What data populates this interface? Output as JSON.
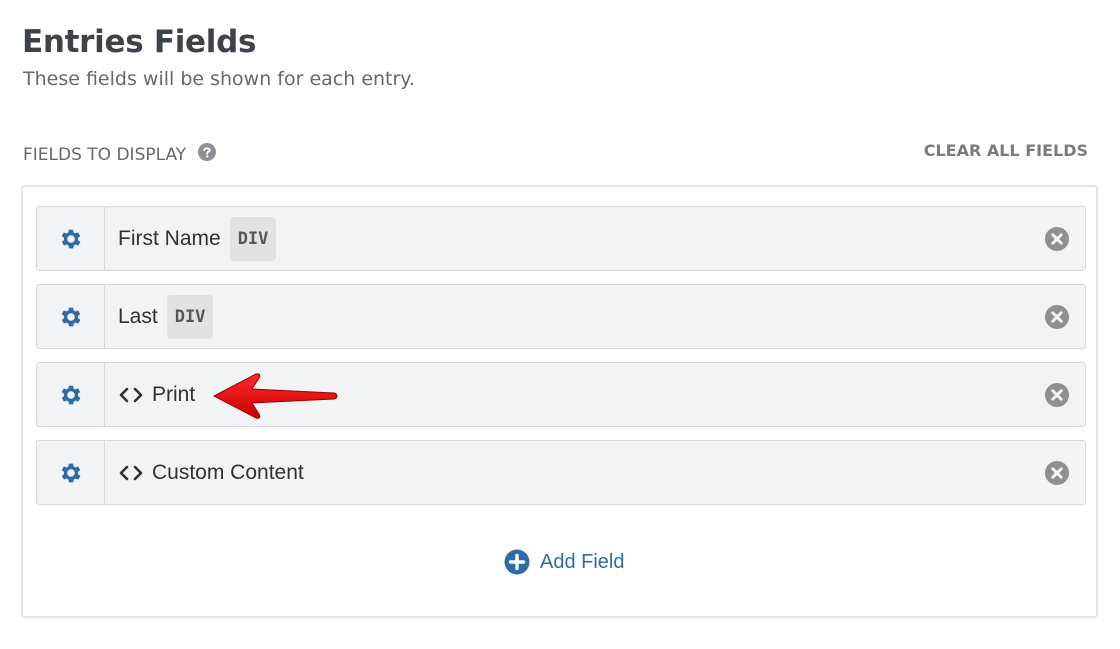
{
  "header": {
    "title": "Entries Fields",
    "subtitle": "These fields will be shown for each entry."
  },
  "section": {
    "label": "FIELDS TO DISPLAY",
    "clear_label": "CLEAR ALL FIELDS"
  },
  "fields": [
    {
      "label": "First Name",
      "tag": "DIV",
      "icon": "none"
    },
    {
      "label": "Last",
      "tag": "DIV",
      "icon": "none"
    },
    {
      "label": "Print",
      "tag": "",
      "icon": "code-icon"
    },
    {
      "label": "Custom Content",
      "tag": "",
      "icon": "code-icon"
    }
  ],
  "add_field": {
    "label": "Add Field",
    "icon": "plus-circle-icon"
  },
  "colors": {
    "gear": "#2f6ba7",
    "remove": "#8c8f94",
    "add": "#2f6ba7",
    "annotation_arrow": "#e01010"
  }
}
